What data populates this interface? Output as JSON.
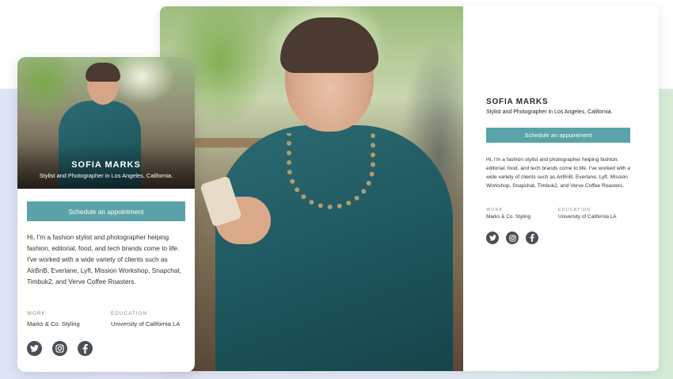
{
  "profile": {
    "name": "SOFIA MARKS",
    "subtitle": "Stylist and Photographer in Los Angeles, California.",
    "subtitle_mobile": "Stylist and Photographer in Los Angeles, California.",
    "cta_label": "Schedule an appointment",
    "bio": "Hi, I'm a fashion stylist and photographer helping fashion, editorial, food, and tech brands come to life. I've worked with a wide variety of clients such as AirBnB, Everlane, Lyft, Mission Workshop, Snapchat, Timbuk2, and Verve Coffee Roasters.",
    "work_label": "WORK",
    "work_value": "Marks & Co. Styling",
    "education_label": "EDUCATION",
    "education_value": "University of California LA",
    "socials": [
      "twitter-icon",
      "instagram-icon",
      "facebook-icon"
    ]
  },
  "colors": {
    "accent": "#5aa3a8",
    "icon": "#4a4f55",
    "text": "#333333"
  }
}
